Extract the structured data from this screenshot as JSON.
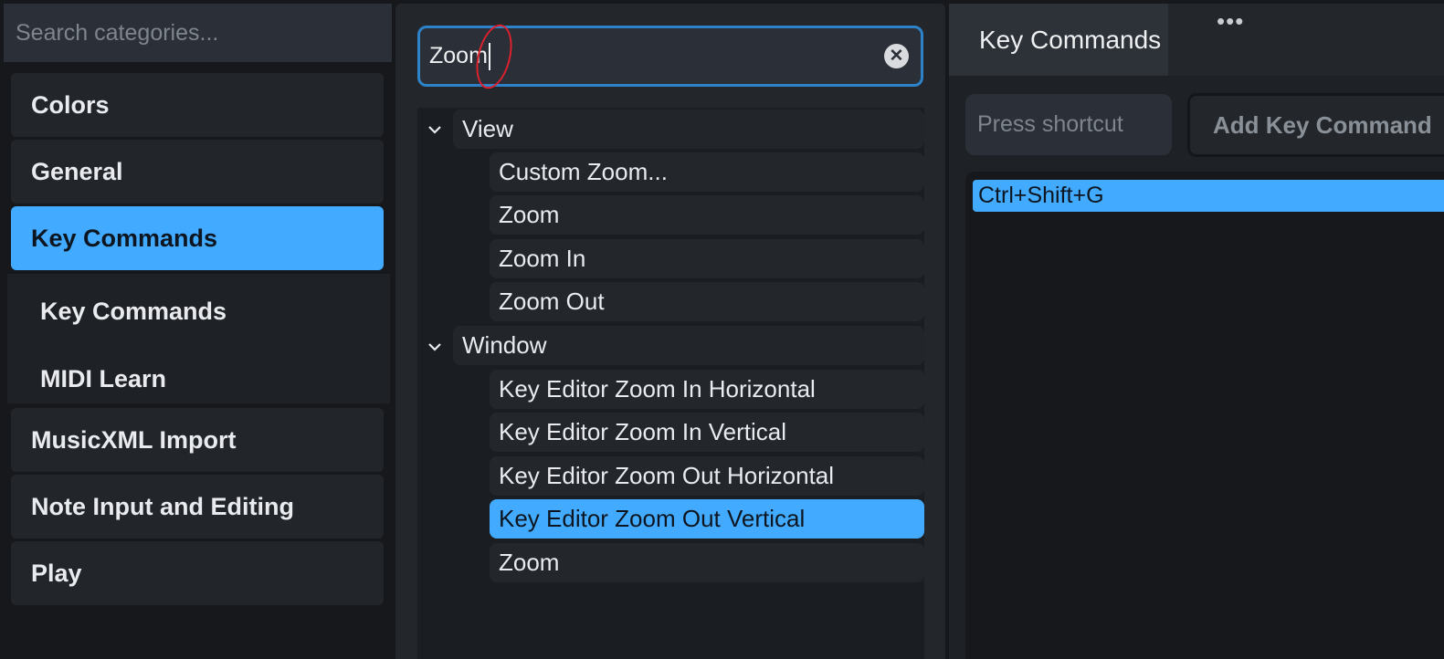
{
  "sidebar": {
    "search_placeholder": "Search categories...",
    "categories": [
      "Colors",
      "General",
      "Key Commands",
      "MusicXML Import",
      "Note Input and Editing",
      "Play"
    ],
    "subcategories": [
      "Key Commands",
      "MIDI Learn"
    ]
  },
  "middle": {
    "search_value": "Zoom",
    "tree": [
      {
        "group": "View",
        "items": [
          "Custom Zoom...",
          "Zoom",
          "Zoom In",
          "Zoom Out"
        ]
      },
      {
        "group": "Window",
        "items": [
          "Key Editor Zoom In Horizontal",
          "Key Editor Zoom In Vertical",
          "Key Editor Zoom Out Horizontal",
          "Key Editor Zoom Out Vertical",
          "Zoom"
        ]
      }
    ]
  },
  "right": {
    "tab_label": "Key Commands",
    "more_label": "•••",
    "shortcut_placeholder": "Press shortcut",
    "add_button_label": "Add Key Command",
    "commands": [
      "Ctrl+Shift+G"
    ]
  },
  "colors": {
    "accent": "#42abff",
    "focus_border": "#2d82c8",
    "annotation": "#e0202d"
  }
}
